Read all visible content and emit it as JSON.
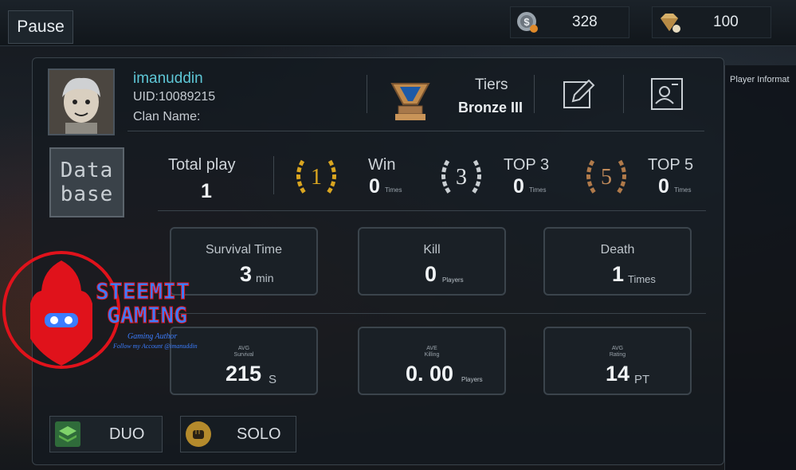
{
  "topbar": {
    "pause_label": "Pause",
    "coins": {
      "icon": "coin-icon",
      "value": "328"
    },
    "gems": {
      "icon": "diamond-icon",
      "value": "100"
    }
  },
  "profile": {
    "username": "imanuddin",
    "uid": "UID:10089215",
    "clan": "Clan Name:",
    "tiers_label": "Tiers",
    "tier": "Bronze III"
  },
  "side_tab": {
    "label": "Player Informat"
  },
  "database_label": [
    "Data",
    "base"
  ],
  "summary": {
    "total_play": {
      "label": "Total play",
      "value": "1"
    },
    "win": {
      "label": "Win",
      "value": "0",
      "unit": "Times",
      "medal": "1"
    },
    "top3": {
      "label": "TOP 3",
      "value": "0",
      "unit": "Times",
      "medal": "3"
    },
    "top5": {
      "label": "TOP 5",
      "value": "0",
      "unit": "Times",
      "medal": "5"
    }
  },
  "cards": {
    "survival": {
      "label": "Survival Time",
      "value": "3",
      "unit": "min"
    },
    "kill": {
      "label": "Kill",
      "value": "0",
      "unit": "Players"
    },
    "death": {
      "label": "Death",
      "value": "1",
      "unit": "Times"
    },
    "avg_survival": {
      "label1": "AVG",
      "label2": "Survival",
      "value": "215",
      "unit": "S"
    },
    "avg_killing": {
      "label1": "AVE",
      "label2": "Killing",
      "value": "0. 00",
      "unit": "Players"
    },
    "avg_rating": {
      "label1": "AVG",
      "label2": "Rating",
      "value": "14",
      "unit": "PT"
    }
  },
  "modes": {
    "duo": "DUO",
    "solo": "SOLO"
  },
  "watermark": {
    "line1": "STEEMIT",
    "line2": "GAMING",
    "line3": "Gaming Author",
    "line4": "Follow my Account @imanuddin"
  },
  "colors": {
    "accent_cyan": "#5ec7d6",
    "gold": "#d9a520",
    "bronze": "#b07a4a",
    "watermark_red": "#e0121b",
    "watermark_blue": "#3b7dff"
  }
}
